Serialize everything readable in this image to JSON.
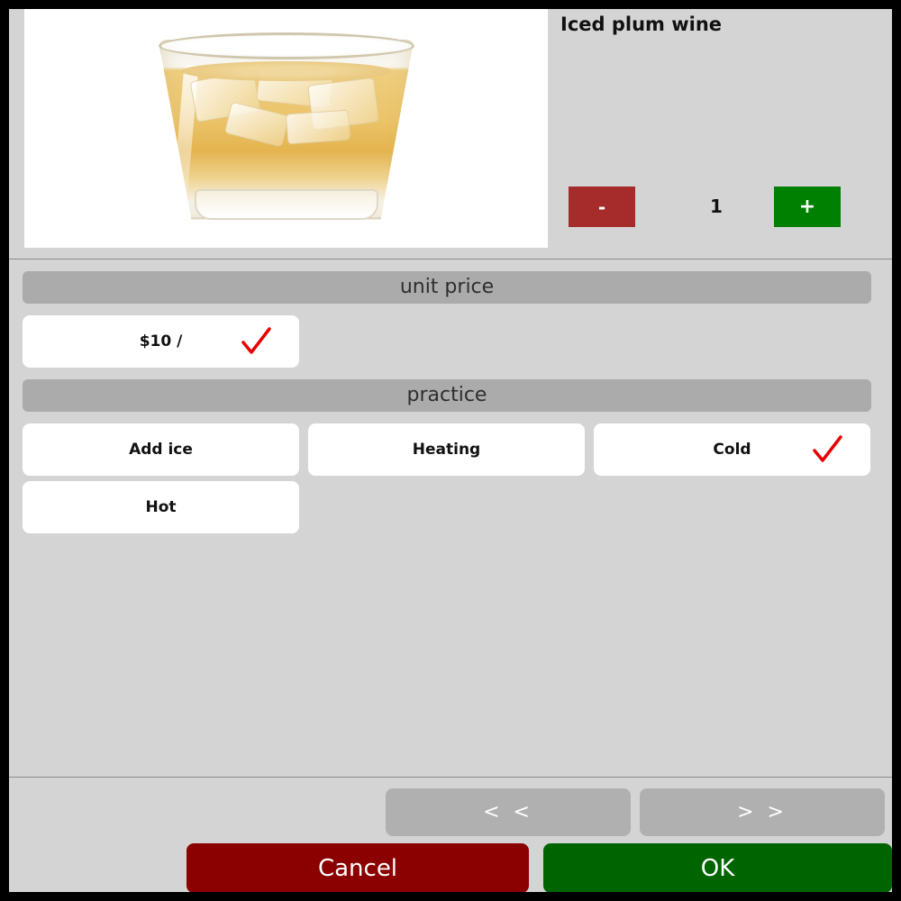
{
  "product": {
    "title": "Iced plum wine",
    "image_alt": "glass-of-iced-plum-wine",
    "quantity": "1",
    "minus_label": "-",
    "plus_label": "+"
  },
  "sections": [
    {
      "header": "unit price",
      "options": [
        {
          "label": "$10 /",
          "selected": true
        }
      ]
    },
    {
      "header": "practice",
      "options": [
        {
          "label": "Add ice",
          "selected": false
        },
        {
          "label": "Heating",
          "selected": false
        },
        {
          "label": "Cold",
          "selected": true
        },
        {
          "label": "Hot",
          "selected": false
        }
      ]
    }
  ],
  "footer": {
    "prev_label": "< <",
    "next_label": "> >",
    "cancel_label": "Cancel",
    "ok_label": "OK"
  },
  "colors": {
    "dialog_bg": "#d4d4d4",
    "section_header_bg": "#ababab",
    "option_bg": "#ffffff",
    "minus_btn": "#a62b2b",
    "plus_btn": "#008000",
    "cancel_btn": "#8b0000",
    "ok_btn": "#006400",
    "page_btn": "#b0b0b0",
    "check_mark": "#e80000",
    "border": "#000000"
  }
}
